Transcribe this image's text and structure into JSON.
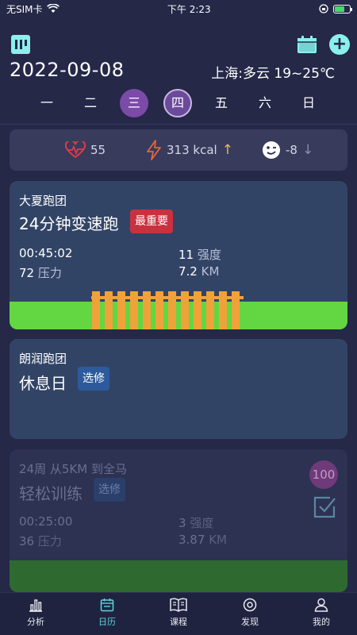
{
  "status_bar": {
    "carrier": "无SIM卡",
    "time": "下午 2:23"
  },
  "header": {
    "date": "2022-09-08",
    "weather": "上海:多云 19~25℃"
  },
  "week": [
    {
      "label": "一",
      "state": "normal"
    },
    {
      "label": "二",
      "state": "normal"
    },
    {
      "label": "三",
      "state": "past"
    },
    {
      "label": "四",
      "state": "today"
    },
    {
      "label": "五",
      "state": "normal"
    },
    {
      "label": "六",
      "state": "normal"
    },
    {
      "label": "日",
      "state": "normal"
    }
  ],
  "stats": {
    "heart_rate": "55",
    "calories": "313 kcal",
    "calories_trend": "↑",
    "mood": "-8",
    "mood_trend": "↓"
  },
  "cards": [
    {
      "team": "大夏跑团",
      "title": "24分钟变速跑",
      "tag": "最重要",
      "duration": "00:45:02",
      "intensity_value": "11",
      "intensity_label": "强度",
      "pressure_value": "72",
      "pressure_label": "压力",
      "distance_value": "7.2",
      "distance_unit": "KM"
    },
    {
      "team": "朗润跑团",
      "title": "休息日",
      "tag": "选修"
    },
    {
      "team": "24周 从5KM 到全马",
      "title": "轻松训练",
      "tag": "选修",
      "score": "100",
      "duration": "00:25:00",
      "intensity_value": "3",
      "intensity_label": "强度",
      "pressure_value": "36",
      "pressure_label": "压力",
      "distance_value": "3.87",
      "distance_unit": "KM"
    }
  ],
  "tabbar": [
    {
      "label": "分析",
      "icon": "chart-icon",
      "active": false
    },
    {
      "label": "日历",
      "icon": "calendar-icon",
      "active": true
    },
    {
      "label": "课程",
      "icon": "book-icon",
      "active": false
    },
    {
      "label": "发现",
      "icon": "discover-icon",
      "active": false
    },
    {
      "label": "我的",
      "icon": "profile-icon",
      "active": false
    }
  ],
  "colors": {
    "background": "#252847",
    "accent": "#8af0ec",
    "tab_active": "#5fd4dc",
    "tag_important": "#c8323e",
    "tag_elective": "#2c5a9c",
    "heart": "#e03a4a",
    "energy": "#e2663a",
    "trend_up": "#e6b85a",
    "green_field": "#62d742",
    "fence": "#f0a23a"
  }
}
